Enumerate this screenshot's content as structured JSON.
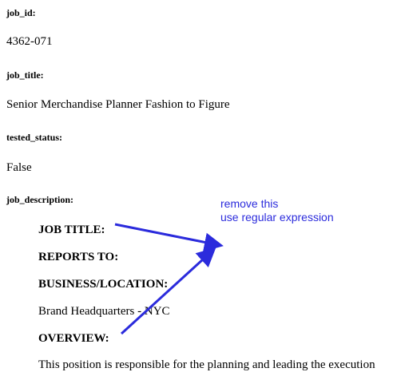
{
  "fields": {
    "job_id": {
      "label": "job_id:",
      "value": "4362-071"
    },
    "job_title": {
      "label": "job_title:",
      "value": "Senior Merchandise Planner Fashion to Figure"
    },
    "tested_status": {
      "label": "tested_status:",
      "value": "False"
    },
    "job_description": {
      "label": "job_description:"
    }
  },
  "description": {
    "heading_job_title": "JOB TITLE:",
    "heading_reports_to": "REPORTS TO:",
    "heading_business_location": "BUSINESS/LOCATION:",
    "location_value": "Brand Headquarters - NYC",
    "heading_overview": "OVERVIEW:",
    "overview_text_partial": "This position is responsible for the planning and leading the execution"
  },
  "annotation": {
    "line1": "remove this",
    "line2": "use regular expression",
    "color": "#2b2bdc"
  }
}
